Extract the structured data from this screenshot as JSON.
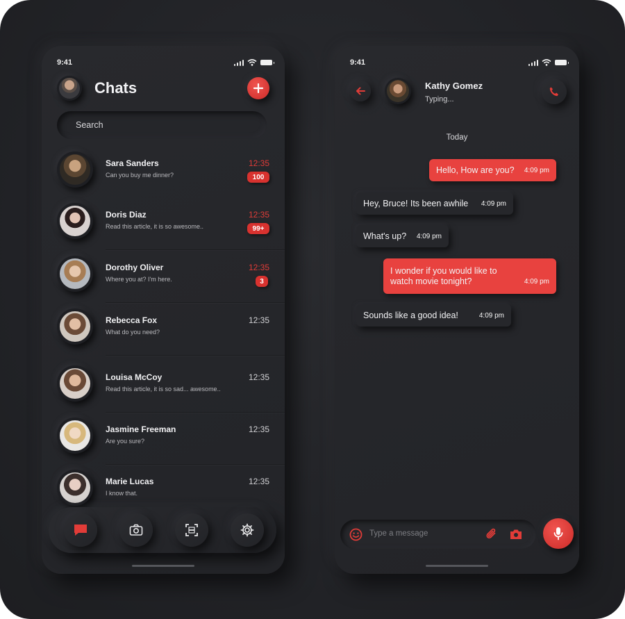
{
  "colors": {
    "accent": "#e8423f",
    "background": "#232428",
    "text": "#f2f2f4"
  },
  "left": {
    "status_time": "9:41",
    "title": "Chats",
    "add_icon": "plus-icon",
    "search_placeholder": "Search",
    "chats": [
      {
        "name": "Sara Sanders",
        "preview": "Can you buy me dinner?",
        "time": "12:35",
        "badge": "100",
        "unread": true
      },
      {
        "name": "Doris Diaz",
        "preview": "Read this article, it is so awesome..",
        "time": "12:35",
        "badge": "99+",
        "unread": true
      },
      {
        "name": "Dorothy Oliver",
        "preview": "Where you at? I'm here.",
        "time": "12:35",
        "badge": "3",
        "unread": true
      },
      {
        "name": "Rebecca Fox",
        "preview": "What do you need?",
        "time": "12:35",
        "badge": "",
        "unread": false
      },
      {
        "name": "Louisa McCoy",
        "preview": "Read this article, it is so sad... awesome..",
        "time": "12:35",
        "badge": "",
        "unread": false
      },
      {
        "name": "Jasmine Freeman",
        "preview": "Are you sure?",
        "time": "12:35",
        "badge": "",
        "unread": false
      },
      {
        "name": "Marie Lucas",
        "preview": "I know that.",
        "time": "12:35",
        "badge": "",
        "unread": false
      }
    ],
    "nav": [
      {
        "name": "chat-icon",
        "active": true
      },
      {
        "name": "camera-icon",
        "active": false
      },
      {
        "name": "scan-icon",
        "active": false
      },
      {
        "name": "gear-icon",
        "active": false
      }
    ]
  },
  "right": {
    "status_time": "9:41",
    "contact_name": "Kathy Gomez",
    "contact_status": "Typing...",
    "date_label": "Today",
    "messages": [
      {
        "dir": "out",
        "text": "Hello, How are you?",
        "time": "4:09 pm"
      },
      {
        "dir": "in",
        "text": "Hey, Bruce! Its been awhile",
        "time": "4:09 pm"
      },
      {
        "dir": "in",
        "text": "What's up?",
        "time": "4:09 pm"
      },
      {
        "dir": "out",
        "text": "I wonder if you would like to\nwatch movie tonight?",
        "time": "4:09 pm"
      },
      {
        "dir": "in",
        "text": "Sounds like a good idea!",
        "time": "4:09 pm"
      }
    ],
    "composer_placeholder": "Type a message"
  }
}
